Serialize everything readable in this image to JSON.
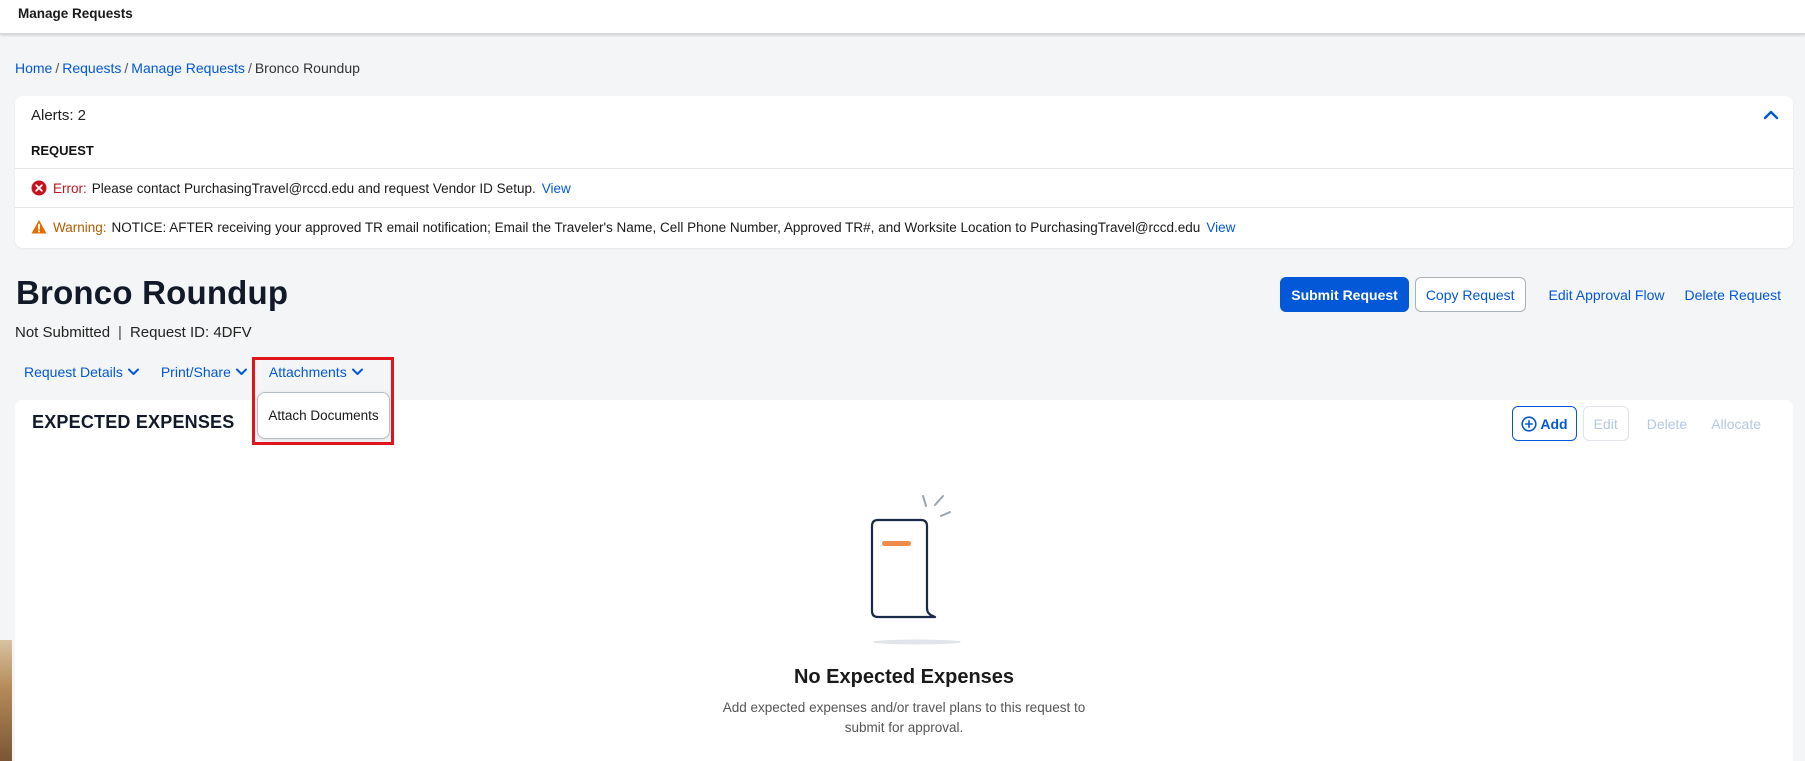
{
  "topbar": {
    "title": "Manage Requests"
  },
  "breadcrumb": {
    "items": [
      "Home",
      "Requests",
      "Manage Requests"
    ],
    "current": "Bronco Roundup",
    "separator": "/"
  },
  "alerts": {
    "title": "Alerts: 2",
    "section_label": "REQUEST",
    "items": [
      {
        "type": "error",
        "label": "Error:",
        "message": "Please contact PurchasingTravel@rccd.edu and request Vendor ID Setup.",
        "link": "View",
        "icon": "error-circle-icon",
        "color": "#c4131b"
      },
      {
        "type": "warning",
        "label": "Warning:",
        "message": "NOTICE: AFTER receiving your approved TR email notification; Email the Traveler's Name, Cell Phone Number, Approved TR#, and Worksite Location to PurchasingTravel@rccd.edu",
        "link": "View",
        "icon": "warning-triangle-icon",
        "color": "#e36c00"
      }
    ]
  },
  "request": {
    "title": "Bronco Roundup",
    "status": "Not Submitted",
    "separator": "|",
    "id_label": "Request ID: 4DFV"
  },
  "actions": {
    "submit": "Submit Request",
    "copy": "Copy Request",
    "edit_flow": "Edit Approval Flow",
    "delete": "Delete Request"
  },
  "subnav": {
    "items": [
      "Request Details",
      "Print/Share",
      "Attachments"
    ]
  },
  "attachments_menu": {
    "items": [
      "Attach Documents"
    ]
  },
  "expenses": {
    "title": "EXPECTED EXPENSES",
    "add": "Add",
    "edit": "Edit",
    "delete": "Delete",
    "allocate": "Allocate",
    "empty_title": "No Expected Expenses",
    "empty_line1": "Add expected expenses and/or travel plans to this request to",
    "empty_line2": "submit for approval."
  },
  "colors": {
    "accent": "#0358d7",
    "highlight": "#e0151c",
    "illustration_stroke": "#1b2a4a",
    "illustration_accent": "#f08a4b"
  }
}
